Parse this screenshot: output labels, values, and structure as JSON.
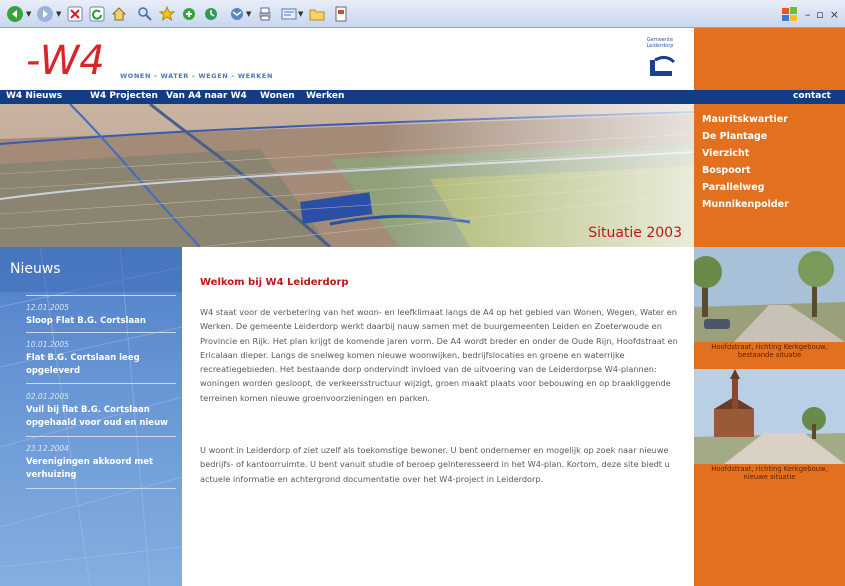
{
  "browser": {
    "window_controls": [
      "–",
      "▫",
      "×"
    ]
  },
  "header": {
    "logo_text": "-W4",
    "tagline": "WONEN – WATER – WEGEN – WERKEN",
    "gemeente_label_1": "Gemeente",
    "gemeente_label_2": "Leiderdorp"
  },
  "nav": {
    "items": [
      "W4 Nieuws",
      "W4 Projecten",
      "Van A4 naar W4",
      "Wonen",
      "Werken"
    ],
    "contact": "contact"
  },
  "hero": {
    "caption": "Situatie 2003"
  },
  "side_links": [
    "Mauritskwartier",
    "De Plantage",
    "Vierzicht",
    "Bospoort",
    "Parallelweg",
    "Munnikenpolder"
  ],
  "photos": [
    {
      "caption_1": "Hoofdstraat, richting Kerkgebouw,",
      "caption_2": "bestaande situatie"
    },
    {
      "caption_1": "Hoofdstraat, richting Kerkgebouw,",
      "caption_2": "nieuwe situatie"
    }
  ],
  "news": {
    "title": "Nieuws",
    "items": [
      {
        "date": "12.01.2005",
        "title": "Sloop Flat B.G. Cortslaan"
      },
      {
        "date": "10.01.2005",
        "title": "Flat B.G. Cortslaan leeg opgeleverd"
      },
      {
        "date": "02.01.2005",
        "title": "Vuil bij flat B.G. Cortslaan opgehaald voor oud en nieuw"
      },
      {
        "date": "23.12.2004",
        "title": "Verenigingen akkoord met verhuizing"
      }
    ]
  },
  "main": {
    "welcome": "Welkom bij W4 Leiderdorp",
    "paragraph_1": "W4 staat voor de verbetering van het woon- en leefklimaat langs de A4 op het gebied van Wonen, Wegen, Water en Werken. De gemeente Leiderdorp werkt daarbij nauw samen met de buurgemeenten Leiden en Zoeterwoude en Provincie en Rijk. Het plan krijgt de komende jaren vorm. De A4 wordt breder en onder de Oude Rijn, Hoofdstraat en Ericalaan dieper. Langs de snelweg komen nieuwe woonwijken, bedrijfslocaties en groene en waterrijke recreatiegebieden. Het bestaande dorp ondervindt invloed van de uitvoering van de Leiderdorpse W4-plannen: woningen worden gesloopt, de verkeersstructuur wijzigt, groen maakt plaats voor bebouwing en op braakliggende terreinen komen nieuwe groenvoorzieningen en parken.",
    "paragraph_2": "U woont in Leiderdorp of ziet uzelf als toekomstige bewoner. U bent ondernemer en mogelijk op zoek naar nieuwe bedrijfs- of kantoorruimte. U bent vanuit studie of beroep geïnteresseerd in het W4-plan. Kortom, deze site biedt u actuele informatie en achtergrond documentatie over het W4-project in Leiderdorp."
  }
}
